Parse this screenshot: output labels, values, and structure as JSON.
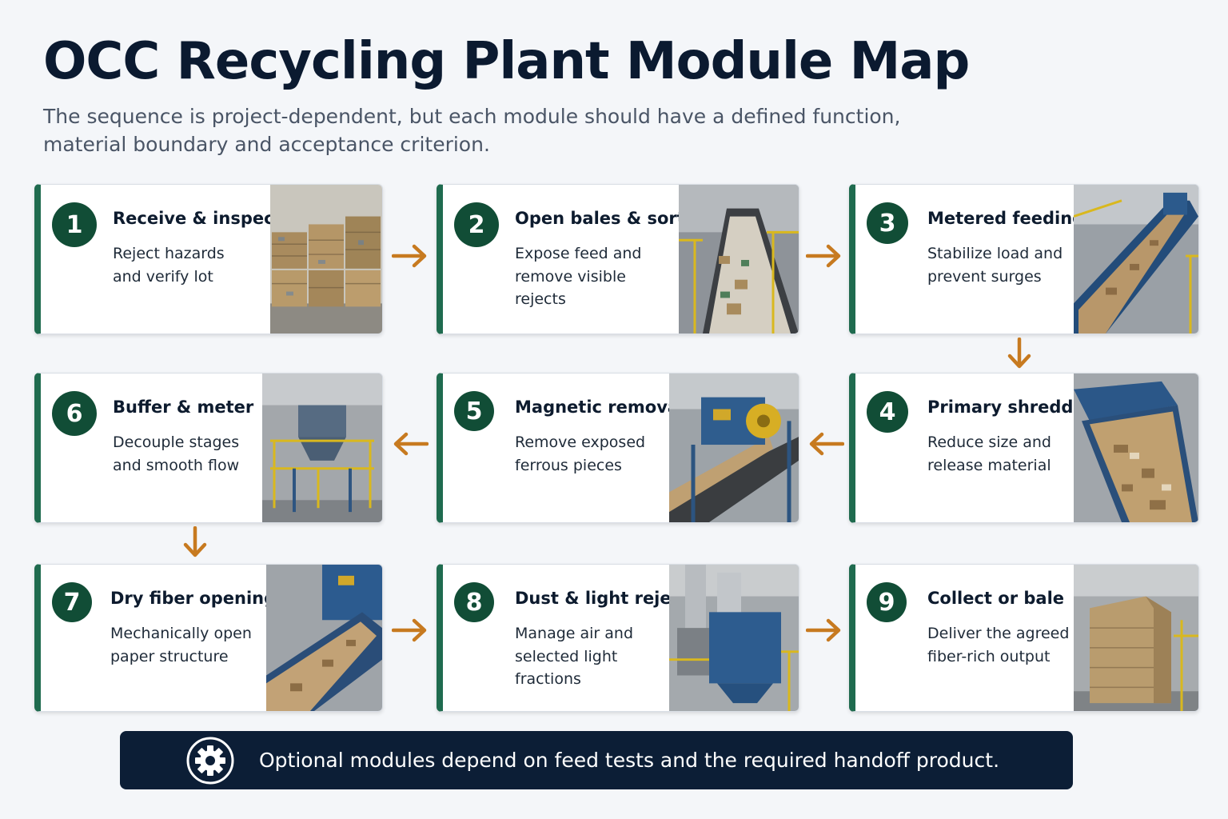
{
  "header": {
    "title": "OCC Recycling Plant Module Map",
    "subtitle": "The sequence is project-dependent, but each module should have a defined function, material boundary and acceptance criterion."
  },
  "modules": [
    {
      "number": "1",
      "title": "Receive & inspect",
      "desc": "Reject hazards and verify lot",
      "image": "stacked-cardboard-bales"
    },
    {
      "number": "2",
      "title": "Open bales & sort",
      "desc": "Expose feed and remove visible rejects",
      "image": "sorting-conveyor"
    },
    {
      "number": "3",
      "title": "Metered feeding",
      "desc": "Stabilize load and prevent surges",
      "image": "inclined-feed-conveyor"
    },
    {
      "number": "4",
      "title": "Primary shredding",
      "desc": "Reduce size and release material",
      "image": "shredder-hopper"
    },
    {
      "number": "5",
      "title": "Magnetic removal",
      "desc": "Remove exposed ferrous pieces",
      "image": "magnetic-separator"
    },
    {
      "number": "6",
      "title": "Buffer & meter",
      "desc": "Decouple stages and smooth flow",
      "image": "buffer-bin-structure"
    },
    {
      "number": "7",
      "title": "Dry fiber opening",
      "desc": "Mechanically open paper structure",
      "image": "fiber-opener-conveyor"
    },
    {
      "number": "8",
      "title": "Dust & light rejects",
      "desc": "Manage air and selected light fractions",
      "image": "dust-collector"
    },
    {
      "number": "9",
      "title": "Collect or bale",
      "desc": "Deliver the agreed fiber-rich output",
      "image": "finished-bale"
    }
  ],
  "footer": {
    "text": "Optional modules depend on feed tests and the required handoff product.",
    "icon": "gear-icon"
  },
  "colors": {
    "accent_green": "#114d36",
    "arrow_orange": "#c77a20",
    "footer_navy": "#0c1e36"
  }
}
